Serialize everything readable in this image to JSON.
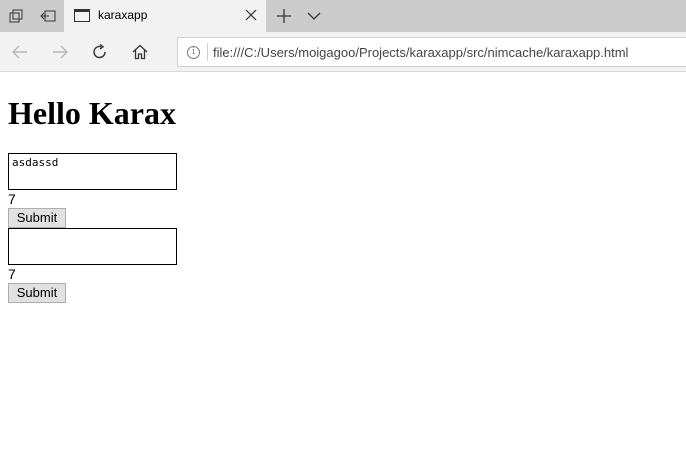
{
  "browser": {
    "tab": {
      "title": "karaxapp"
    },
    "address": {
      "url": "file:///C:/Users/moigagoo/Projects/karaxapp/src/nimcache/karaxapp.html"
    }
  },
  "page": {
    "title": "Hello Karax",
    "forms": [
      {
        "value": "asdassd",
        "count": "7",
        "submit_label": "Submit"
      },
      {
        "value": "",
        "count": "7",
        "submit_label": "Submit"
      }
    ]
  }
}
